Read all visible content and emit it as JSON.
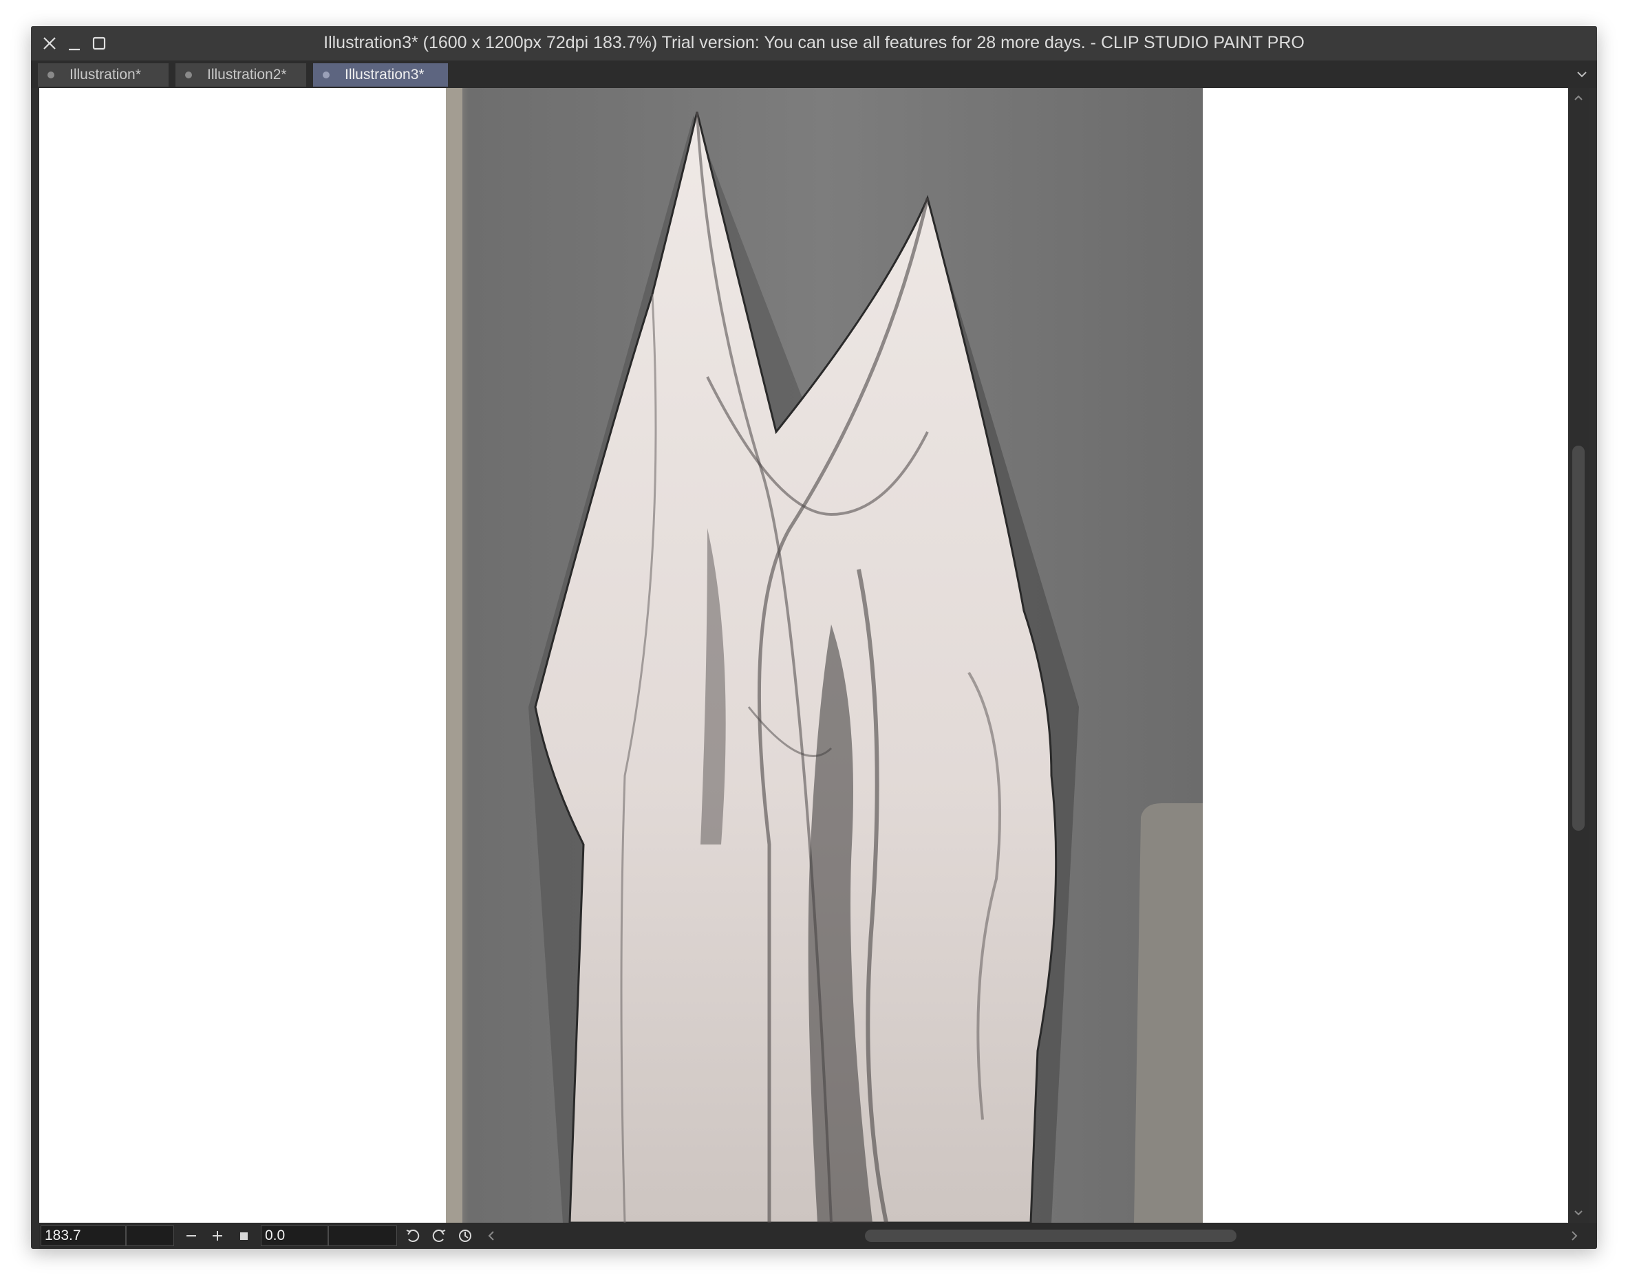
{
  "window": {
    "title": "Illustration3* (1600 x 1200px 72dpi 183.7%)  Trial version: You can use all features for 28 more days. - CLIP STUDIO PAINT PRO"
  },
  "tabs": [
    {
      "label": "Illustration*",
      "active": false
    },
    {
      "label": "Illustration2*",
      "active": false
    },
    {
      "label": "Illustration3*",
      "active": true
    }
  ],
  "statusbar": {
    "zoom_value": "183.7",
    "zoom_secondary": "",
    "rotation_value": "0.0",
    "rotation_secondary": ""
  },
  "icons": {
    "close": "close-icon",
    "minimize": "minimize-icon",
    "maximize": "maximize-icon",
    "tab_dropdown": "chevron-down-icon",
    "zoom_out": "minus-icon",
    "zoom_in": "plus-icon",
    "fit": "square-icon",
    "rotate_left": "rotate-left-icon",
    "rotate_right": "rotate-right-icon",
    "reset_rotation": "reset-icon"
  },
  "colors": {
    "titlebar": "#3a3a3a",
    "active_tab": "#5d6580",
    "canvas_bg": "#ffffff",
    "artwork_wall": "#7a7a7a"
  }
}
